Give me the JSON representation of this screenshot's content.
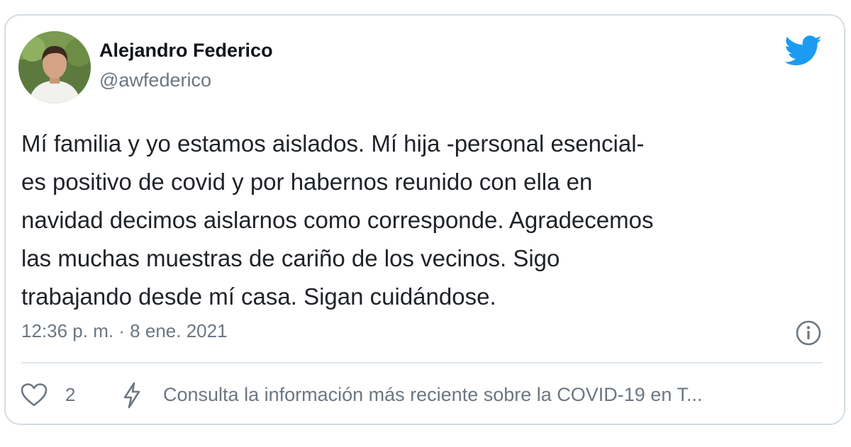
{
  "tweet": {
    "author_name": "Alejandro Federico",
    "author_handle": "@awfederico",
    "text_lines": [
      "Mí familia y yo estamos aislados. Mí hija -personal esencial-",
      "es positivo de covid y por habernos reunido con ella en",
      "navidad decimos aislarnos como corresponde. Agradecemos",
      "las muchas muestras de cariño de los vecinos. Sigo",
      "trabajando desde mí casa. Sigan cuidándose."
    ],
    "timestamp": "12:36 p. m. · 8 ene. 2021",
    "like_count": "2",
    "covid_notice": "Consulta la información más reciente sobre la COVID-19 en T..."
  },
  "icons": {
    "brand": "twitter-bird-icon",
    "info": "info-icon",
    "like": "heart-icon",
    "notice": "bolt-icon"
  },
  "colors": {
    "twitter_blue": "#1d9bf0",
    "text_primary": "#111418",
    "text_secondary": "#6b7782",
    "border": "#d3dde4"
  }
}
